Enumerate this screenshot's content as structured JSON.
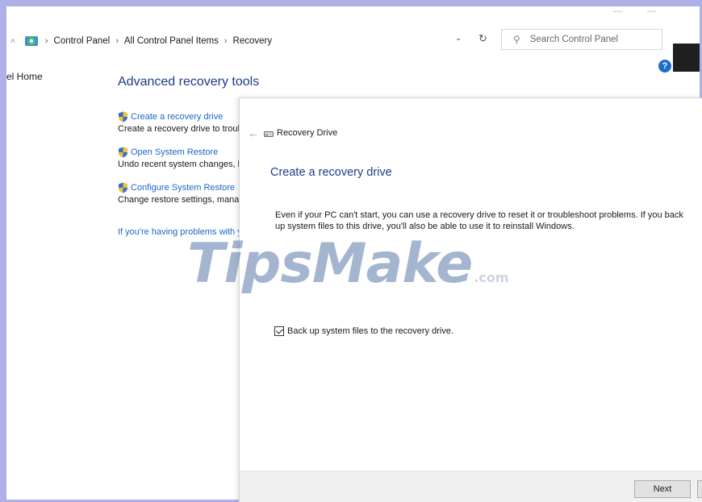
{
  "window": {
    "minimize_glyph": "—",
    "maximize_glyph": "—",
    "help_glyph": "?"
  },
  "address_bar": {
    "breadcrumbs": [
      "Control Panel",
      "All Control Panel Items",
      "Recovery"
    ],
    "separator": "›",
    "dropdown_glyph": "⌄",
    "refresh_glyph": "↻"
  },
  "search": {
    "placeholder": "Search Control Panel"
  },
  "left_nav": {
    "home_link": "el Home"
  },
  "main": {
    "section_title": "Advanced recovery tools",
    "tools": [
      {
        "link": "Create a recovery drive",
        "desc": "Create a recovery drive to troubleshoot problems when your PC can't start."
      },
      {
        "link": "Open System Restore",
        "desc": "Undo recent system changes, but leave files such as documents, pictures, and music unchanged."
      },
      {
        "link": "Configure System Restore",
        "desc": "Change restore settings, manage disk space, and create or delete restore points."
      }
    ],
    "problems_link": "If you're having problems with your PC, you can refresh it or reset it."
  },
  "dialog": {
    "back_glyph": "←",
    "app_title": "Recovery Drive",
    "heading": "Create a recovery drive",
    "body": "Even if your PC can't start, you can use a recovery drive to reset it or troubleshoot problems. If you back up system files to this drive, you'll also be able to use it to reinstall Windows.",
    "checkbox_label": "Back up system files to the recovery drive.",
    "checkbox_checked": true,
    "next_label": "Next"
  },
  "watermark": {
    "main": "TipsMake",
    "suffix": ".com"
  },
  "colors": {
    "heading": "#1e3a8a",
    "link": "#1e66c7",
    "frame": "#b0b0e8"
  }
}
